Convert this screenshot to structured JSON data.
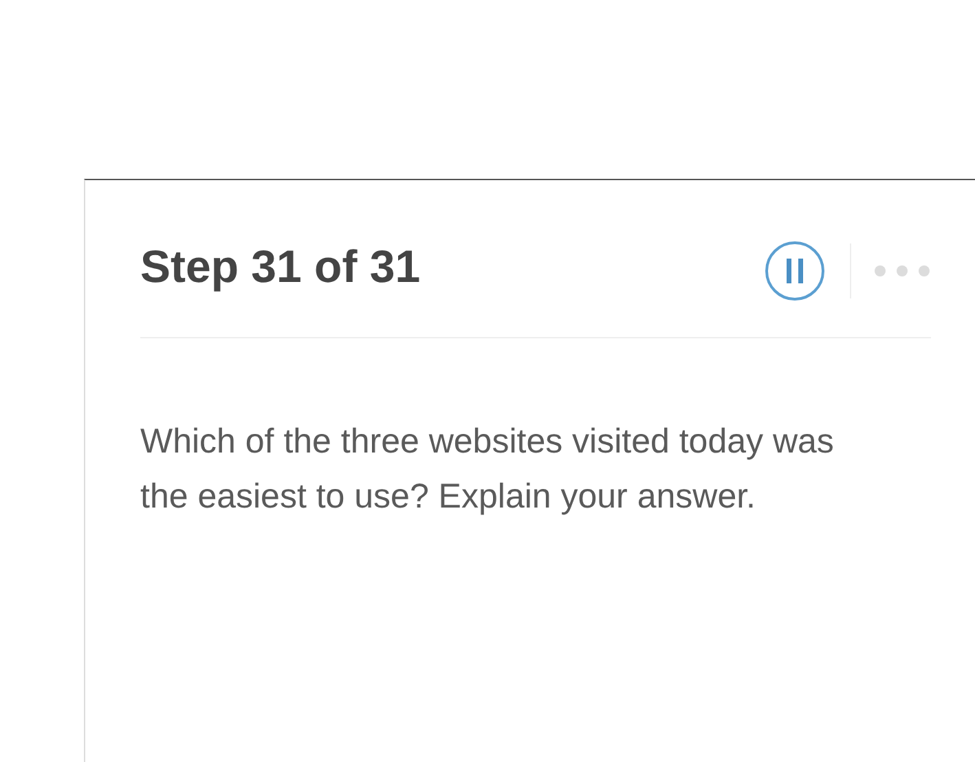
{
  "panel": {
    "title": "Step 31 of 31",
    "question": "Which of the three websites visited today was the easiest to use? Explain your answer."
  }
}
